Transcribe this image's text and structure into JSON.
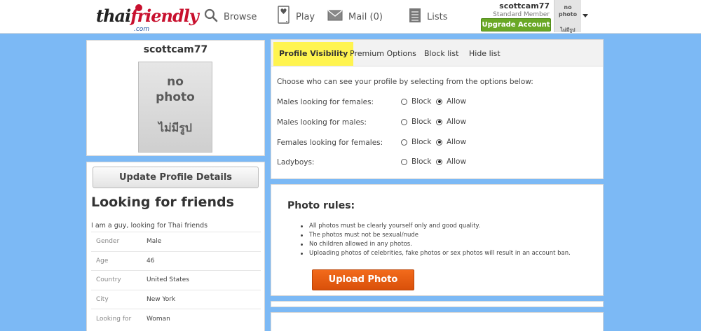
{
  "logo": {
    "brand_main": "thai",
    "brand_accent": "friendly",
    "brand_domain": ".com"
  },
  "nav": {
    "browse": "Browse",
    "play": "Play",
    "mail": "Mail (0)",
    "lists": "Lists"
  },
  "account": {
    "username": "scottcam77",
    "level": "Standard Member",
    "upgrade_label": "Upgrade Account",
    "avatar_text_1": "no",
    "avatar_text_2": "photo",
    "avatar_text_thai": "ไม่มีรูป"
  },
  "profile": {
    "username": "scottcam77",
    "nophoto_1": "no",
    "nophoto_2": "photo",
    "nophoto_thai": "ไม่มีรูป",
    "update_label": "Update Profile Details",
    "looking_title": "Looking for friends",
    "intro": "I am a guy, looking for Thai friends",
    "fields": [
      {
        "key": "Gender",
        "value": "Male"
      },
      {
        "key": "Age",
        "value": "46"
      },
      {
        "key": "Country",
        "value": "United States"
      },
      {
        "key": "City",
        "value": "New York"
      },
      {
        "key": "Looking for",
        "value": "Woman"
      }
    ]
  },
  "visibility": {
    "tabs": [
      "Profile Visibility",
      "Premium Options",
      "Block list",
      "Hide list"
    ],
    "intro": "Choose who can see your profile by selecting from the options below:",
    "block_label": "Block",
    "allow_label": "Allow",
    "rows": [
      {
        "label": "Males looking for females:",
        "selected": "Allow"
      },
      {
        "label": "Males looking for males:",
        "selected": "Allow"
      },
      {
        "label": "Females looking for females:",
        "selected": "Allow"
      },
      {
        "label": "Ladyboys:",
        "selected": "Allow"
      }
    ]
  },
  "photo_rules": {
    "title": "Photo rules:",
    "rules": [
      "All photos must be clearly yourself only and good quality.",
      "The photos must not be sexual/nude",
      "No children allowed in any photos.",
      "Uploading photos of celebrities, fake photos or sex photos will result in an account ban."
    ],
    "upload_label": "Upload Photo"
  },
  "colors": {
    "background": "#7cb9f5",
    "upgrade": "#6aa826",
    "upload": "#f26a1b",
    "active_tab": "#fff44f"
  }
}
